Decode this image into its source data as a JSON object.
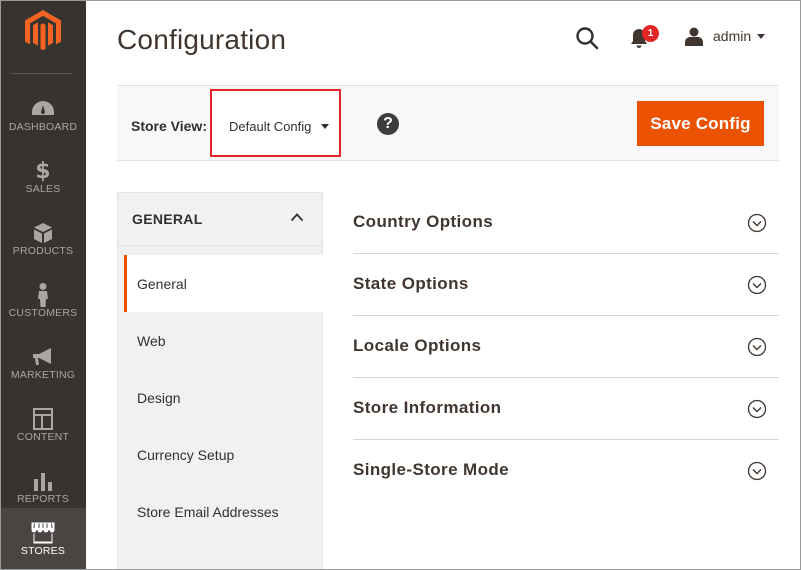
{
  "app": {
    "page_title": "Configuration"
  },
  "sidebar": {
    "items": [
      {
        "label": "DASHBOARD",
        "icon": "dashboard-icon",
        "active": false
      },
      {
        "label": "SALES",
        "icon": "dollar-icon",
        "active": false
      },
      {
        "label": "PRODUCTS",
        "icon": "box-icon",
        "active": false
      },
      {
        "label": "CUSTOMERS",
        "icon": "person-icon",
        "active": false
      },
      {
        "label": "MARKETING",
        "icon": "megaphone-icon",
        "active": false
      },
      {
        "label": "CONTENT",
        "icon": "layout-icon",
        "active": false
      },
      {
        "label": "REPORTS",
        "icon": "bar-chart-icon",
        "active": false
      },
      {
        "label": "STORES",
        "icon": "store-icon",
        "active": true
      }
    ]
  },
  "header": {
    "notifications_count": "1",
    "user_name": "admin"
  },
  "store_bar": {
    "label": "Store View:",
    "selected": "Default Config",
    "help_symbol": "?",
    "save_label": "Save Config"
  },
  "tabs": {
    "group_title": "GENERAL",
    "items": [
      {
        "label": "General",
        "active": true
      },
      {
        "label": "Web",
        "active": false
      },
      {
        "label": "Design",
        "active": false
      },
      {
        "label": "Currency Setup",
        "active": false
      },
      {
        "label": "Store Email Addresses",
        "active": false
      }
    ]
  },
  "sections": [
    {
      "title": "Country Options"
    },
    {
      "title": "State Options"
    },
    {
      "title": "Locale Options"
    },
    {
      "title": "Store Information"
    },
    {
      "title": "Single-Store Mode"
    }
  ],
  "colors": {
    "sidebar_bg": "#373330",
    "accent": "#eb5202",
    "highlight_box": "#e0262a",
    "badge": "#e22626"
  }
}
